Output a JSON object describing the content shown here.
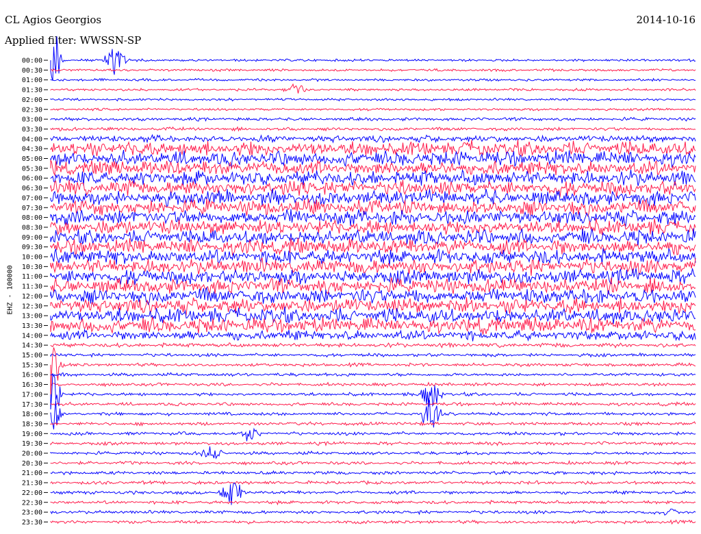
{
  "header": {
    "station": "CL Agios Georgios",
    "filter": "Applied filter: WWSSN-SP",
    "date": "2014-10-16",
    "channel": "EHZ - 100000"
  },
  "colors": {
    "trace_a": "#0000ff",
    "trace_b": "#ff1a4a"
  },
  "chart_data": {
    "type": "line",
    "title": "CL Agios Georgios",
    "subtitle": "Applied filter: WWSSN-SP",
    "ylabel": "EHZ - 100000",
    "categories": [
      "00:00",
      "00:30",
      "01:00",
      "01:30",
      "02:00",
      "02:30",
      "03:00",
      "03:30",
      "04:00",
      "04:30",
      "05:00",
      "05:30",
      "06:00",
      "06:30",
      "07:00",
      "07:30",
      "08:00",
      "08:30",
      "09:00",
      "09:30",
      "10:00",
      "10:30",
      "11:00",
      "11:30",
      "12:00",
      "12:30",
      "13:00",
      "13:30",
      "14:00",
      "14:30",
      "15:00",
      "15:30",
      "16:00",
      "16:30",
      "17:00",
      "17:30",
      "18:00",
      "18:30",
      "19:00",
      "19:30",
      "20:00",
      "20:30",
      "21:00",
      "21:30",
      "22:00",
      "22:30",
      "23:00",
      "23:30"
    ],
    "noise_level": [
      1.5,
      1.5,
      1.5,
      1.5,
      1.5,
      1.5,
      2,
      2,
      4,
      9,
      9,
      9,
      9,
      9,
      9,
      9,
      9,
      9,
      9,
      9,
      9,
      9,
      9,
      9,
      9,
      9,
      9,
      9,
      6,
      2.5,
      2,
      2,
      2,
      2,
      2,
      2,
      2,
      2,
      2,
      2,
      2,
      2,
      2,
      2,
      2,
      2,
      2,
      2
    ],
    "events": [
      {
        "row": 0,
        "x_frac": 0.0,
        "amp": 90
      },
      {
        "row": 0,
        "x_frac": 0.1,
        "amp": 40
      },
      {
        "row": 3,
        "x_frac": 0.38,
        "amp": 12
      },
      {
        "row": 31,
        "x_frac": 0.0,
        "amp": 60
      },
      {
        "row": 34,
        "x_frac": 0.0,
        "amp": 50
      },
      {
        "row": 34,
        "x_frac": 0.59,
        "amp": 30
      },
      {
        "row": 36,
        "x_frac": 0.0,
        "amp": 40
      },
      {
        "row": 36,
        "x_frac": 0.59,
        "amp": 40
      },
      {
        "row": 38,
        "x_frac": 0.31,
        "amp": 14
      },
      {
        "row": 40,
        "x_frac": 0.25,
        "amp": 12
      },
      {
        "row": 44,
        "x_frac": 0.28,
        "amp": 28
      },
      {
        "row": 46,
        "x_frac": 0.96,
        "amp": 6
      }
    ]
  }
}
